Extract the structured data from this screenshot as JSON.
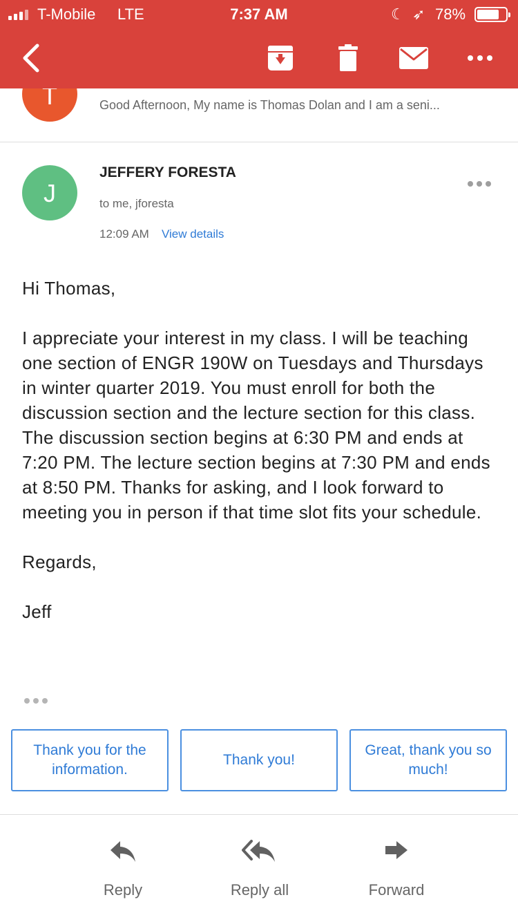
{
  "status_bar": {
    "carrier": "T-Mobile",
    "network": "LTE",
    "time": "7:37 AM",
    "moon": "☾",
    "location": "➶",
    "battery": "78%",
    "battery_level": 0.78
  },
  "toolbar": {
    "icons": [
      "back-icon",
      "archive-icon",
      "trash-icon",
      "mail-icon",
      "more-icon"
    ]
  },
  "previous_message": {
    "avatar_letter": "T",
    "avatar_color": "#e8572d",
    "snippet": "Good Afternoon, My name is Thomas Dolan and I am a seni..."
  },
  "message": {
    "avatar_letter": "J",
    "avatar_color": "#5fbf82",
    "sender": "JEFFERY FORESTA",
    "recipients": "to me, jforesta",
    "time": "12:09 AM",
    "view_details": "View details",
    "body": {
      "greeting": "Hi Thomas,",
      "paragraph": "I appreciate your interest in my class. I will be teaching one section of ENGR 190W on Tuesdays and Thursdays in winter quarter 2019. You must enroll for both the discussion section and the lecture section for this class. The discussion section begins at 6:30 PM and ends at 7:20 PM. The lecture section begins at 7:30 PM and ends at 8:50 PM. Thanks for asking, and I look forward to meeting you in person if that time slot fits your schedule.",
      "closing": "Regards,",
      "signature": "Jeff"
    }
  },
  "smart_replies": [
    "Thank you for the information.",
    "Thank you!",
    "Great, thank you so much!"
  ],
  "actions": {
    "reply": "Reply",
    "reply_all": "Reply all",
    "forward": "Forward"
  },
  "colors": {
    "toolbar": "#d9423b",
    "link": "#2f7bd6",
    "accent_border": "#4a8fe0"
  }
}
